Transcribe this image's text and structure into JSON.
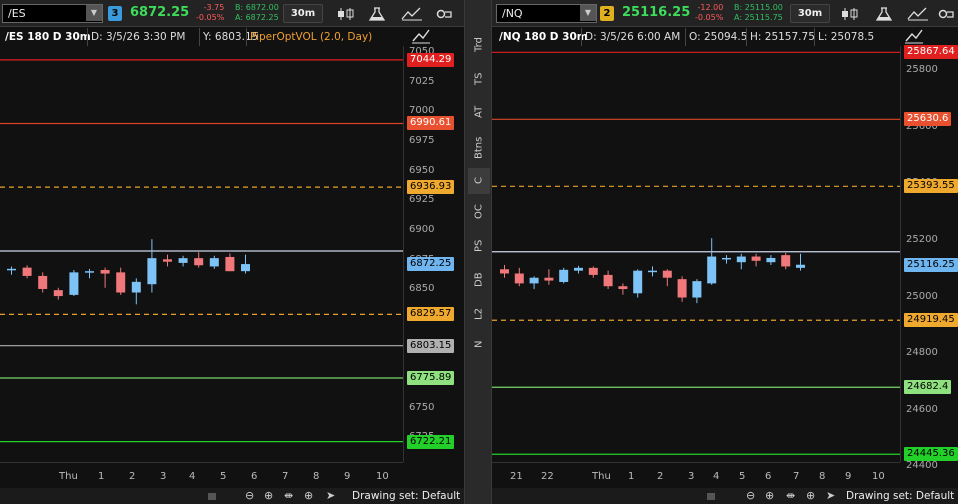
{
  "sidebar": {
    "tabs": [
      "Trd",
      "TS",
      "AT",
      "Btns",
      "C",
      "OC",
      "PS",
      "DB",
      "L2",
      "N"
    ],
    "selected": "C"
  },
  "charts": [
    {
      "symbol": "/ES",
      "link_number": "3",
      "link_color": "#3a9bdc",
      "last_price": "6872.25",
      "change": "-3.75",
      "change_pct": "-0.05%",
      "bid": "B: 6872.00",
      "ask": "A: 6872.25",
      "timeframe": "30m",
      "info_title": "/ES 180 D 30m",
      "info_date": "D: 3/5/26 3:30 PM",
      "info_extra": "Y: 6803.15",
      "study_label": "PiperOptVOL (2.0, Day)",
      "drawing_set": "Drawing set: Default",
      "y_range": [
        6705,
        7056
      ],
      "y_ticks": [
        "7050",
        "7025",
        "7000",
        "6975",
        "6950",
        "6925",
        "6900",
        "6875",
        "6850",
        "6825",
        "6800",
        "6775",
        "6750",
        "6725"
      ],
      "x_labels": [
        "Thu",
        "1",
        "2",
        "3",
        "4",
        "5",
        "6",
        "7",
        "8",
        "9",
        "10"
      ],
      "levels": [
        {
          "label": "7044.29",
          "value": 7044.29,
          "color": "#e0201f",
          "bg": "#e0201f",
          "fg": "#fff",
          "style": "solid"
        },
        {
          "label": "6990.61",
          "value": 6990.61,
          "color": "#d84427",
          "bg": "#e8502f",
          "fg": "#fff",
          "style": "solid"
        },
        {
          "label": "6936.93",
          "value": 6936.93,
          "color": "#e8a22a",
          "bg": "#f0a92f",
          "fg": "#000",
          "style": "dashed"
        },
        {
          "label": "6872.25",
          "value": 6883.0,
          "color": "#ccd6e8",
          "bg": "#6fb5f0",
          "fg": "#000",
          "style": "solid"
        },
        {
          "label": "6829.57",
          "value": 6829.57,
          "color": "#e8a22a",
          "bg": "#f0a92f",
          "fg": "#000",
          "style": "dashed"
        },
        {
          "label": "6803.15",
          "value": 6803.15,
          "color": "#b0b0b0",
          "bg": "#b0b0b0",
          "fg": "#000",
          "style": "solid"
        },
        {
          "label": "6775.89",
          "value": 6775.89,
          "color": "#78d46a",
          "bg": "#8fe07e",
          "fg": "#000",
          "style": "solid"
        },
        {
          "label": "6722.21",
          "value": 6722.21,
          "color": "#23d02a",
          "bg": "#23d02a",
          "fg": "#000",
          "style": "solid"
        }
      ],
      "candles": [
        {
          "o": 6867,
          "h": 6870,
          "l": 6863,
          "c": 6868
        },
        {
          "o": 6869,
          "h": 6871,
          "l": 6860,
          "c": 6862
        },
        {
          "o": 6862,
          "h": 6865,
          "l": 6848,
          "c": 6851
        },
        {
          "o": 6850,
          "h": 6852,
          "l": 6842,
          "c": 6845
        },
        {
          "o": 6846,
          "h": 6867,
          "l": 6845,
          "c": 6865
        },
        {
          "o": 6865,
          "h": 6868,
          "l": 6860,
          "c": 6866
        },
        {
          "o": 6867,
          "h": 6869,
          "l": 6852,
          "c": 6864
        },
        {
          "o": 6865,
          "h": 6869,
          "l": 6846,
          "c": 6848
        },
        {
          "o": 6848,
          "h": 6860,
          "l": 6838,
          "c": 6857
        },
        {
          "o": 6855,
          "h": 6893,
          "l": 6848,
          "c": 6877
        },
        {
          "o": 6876,
          "h": 6880,
          "l": 6870,
          "c": 6874
        },
        {
          "o": 6873,
          "h": 6879,
          "l": 6870,
          "c": 6877
        },
        {
          "o": 6877,
          "h": 6882,
          "l": 6869,
          "c": 6871
        },
        {
          "o": 6870,
          "h": 6879,
          "l": 6868,
          "c": 6877
        },
        {
          "o": 6878,
          "h": 6881,
          "l": 6866,
          "c": 6866
        },
        {
          "o": 6866,
          "h": 6880,
          "l": 6864,
          "c": 6872
        }
      ]
    },
    {
      "symbol": "/NQ",
      "link_number": "2",
      "link_color": "#e0b020",
      "last_price": "25116.25",
      "change": "-12.00",
      "change_pct": "-0.05%",
      "bid": "B: 25115.00",
      "ask": "A: 25115.75",
      "timeframe": "30m",
      "info_title": "/NQ 180 D 30m",
      "info_date": "D: 3/5/26 6:00 AM",
      "info_extra": "O: 25094.5",
      "info_high": "H: 25157.75",
      "info_low": "L: 25078.5",
      "drawing_set": "Drawing set: Default",
      "y_range": [
        24418,
        25890
      ],
      "y_ticks": [
        "25800",
        "25600",
        "25400",
        "25200",
        "25000",
        "24800",
        "24600",
        "24400"
      ],
      "x_labels": [
        "21",
        "22",
        "Thu",
        "1",
        "2",
        "3",
        "4",
        "5",
        "6",
        "7",
        "8",
        "9",
        "10"
      ],
      "levels": [
        {
          "label": "25867.64",
          "value": 25867.64,
          "color": "#e0201f",
          "bg": "#e0201f",
          "fg": "#fff",
          "style": "solid"
        },
        {
          "label": "25630.6",
          "value": 25630.6,
          "color": "#d84427",
          "bg": "#e8502f",
          "fg": "#fff",
          "style": "solid"
        },
        {
          "label": "25393.55",
          "value": 25393.55,
          "color": "#e8a22a",
          "bg": "#f0a92f",
          "fg": "#000",
          "style": "dashed"
        },
        {
          "label": "25116.25",
          "value": 25162.0,
          "color": "#ccd6e8",
          "bg": "#6fb5f0",
          "fg": "#000",
          "style": "solid"
        },
        {
          "label": "24919.45",
          "value": 24919.45,
          "color": "#e8a22a",
          "bg": "#f0a92f",
          "fg": "#000",
          "style": "dashed"
        },
        {
          "label": "24682.4",
          "value": 24682.4,
          "color": "#78d46a",
          "bg": "#8fe07e",
          "fg": "#000",
          "style": "solid"
        },
        {
          "label": "24445.36",
          "value": 24445.36,
          "color": "#23d02a",
          "bg": "#23d02a",
          "fg": "#000",
          "style": "solid"
        }
      ],
      "candles": [
        {
          "o": 25100,
          "h": 25115,
          "l": 25070,
          "c": 25085
        },
        {
          "o": 25085,
          "h": 25105,
          "l": 25040,
          "c": 25050
        },
        {
          "o": 25050,
          "h": 25075,
          "l": 25030,
          "c": 25070
        },
        {
          "o": 25070,
          "h": 25100,
          "l": 25045,
          "c": 25060
        },
        {
          "o": 25055,
          "h": 25105,
          "l": 25050,
          "c": 25098
        },
        {
          "o": 25095,
          "h": 25112,
          "l": 25085,
          "c": 25105
        },
        {
          "o": 25105,
          "h": 25110,
          "l": 25070,
          "c": 25080
        },
        {
          "o": 25080,
          "h": 25095,
          "l": 25030,
          "c": 25040
        },
        {
          "o": 25040,
          "h": 25050,
          "l": 25010,
          "c": 25030
        },
        {
          "o": 25015,
          "h": 25100,
          "l": 25000,
          "c": 25095
        },
        {
          "o": 25095,
          "h": 25110,
          "l": 25075,
          "c": 25095
        },
        {
          "o": 25095,
          "h": 25100,
          "l": 25040,
          "c": 25070
        },
        {
          "o": 25065,
          "h": 25075,
          "l": 24985,
          "c": 25000
        },
        {
          "o": 25000,
          "h": 25065,
          "l": 24980,
          "c": 25058
        },
        {
          "o": 25050,
          "h": 25210,
          "l": 25045,
          "c": 25145
        },
        {
          "o": 25135,
          "h": 25150,
          "l": 25120,
          "c": 25140
        },
        {
          "o": 25125,
          "h": 25155,
          "l": 25100,
          "c": 25145
        },
        {
          "o": 25145,
          "h": 25155,
          "l": 25110,
          "c": 25130
        },
        {
          "o": 25125,
          "h": 25150,
          "l": 25115,
          "c": 25140
        },
        {
          "o": 25150,
          "h": 25158,
          "l": 25100,
          "c": 25110
        },
        {
          "o": 25105,
          "h": 25155,
          "l": 25095,
          "c": 25116
        }
      ]
    }
  ]
}
